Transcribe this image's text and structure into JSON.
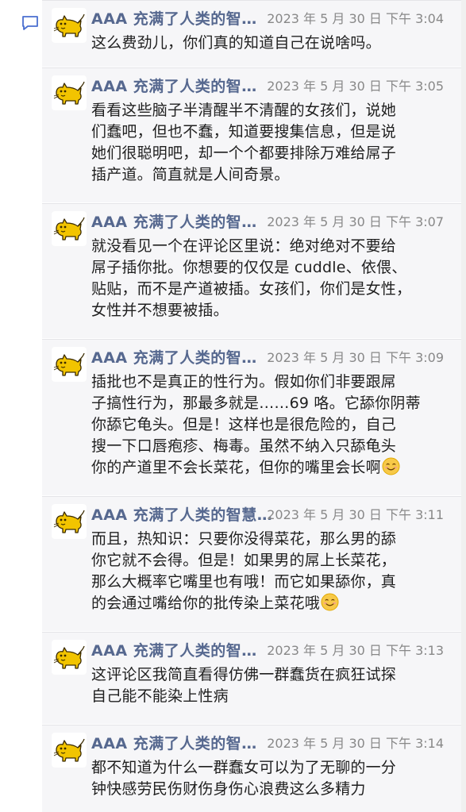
{
  "sidebar": {
    "icon": "comment-icon"
  },
  "colors": {
    "author": "#56688f",
    "timestamp": "#888888",
    "text": "#1f1f1f",
    "background": "#f6f6f8"
  },
  "comments": [
    {
      "author": "AAA 充满了人类的智…",
      "time": "2023 年 5 月 30 日 下午 3:04",
      "lines": [
        "这么费劲儿，你们真的知道自己在说啥吗。"
      ]
    },
    {
      "author": "AAA 充满了人类的智…",
      "time": "2023 年 5 月 30 日 下午 3:05",
      "lines": [
        "看看这些脑子半清醒半不清醒的女孩们，说她",
        "们蠢吧，但也不蠢，知道要搜集信息，但是说",
        "她们很聪明吧，却一个个都要排除万难给屌子",
        "插产道。简直就是人间奇景。"
      ]
    },
    {
      "author": "AAA 充满了人类的智…",
      "time": "2023 年 5 月 30 日 下午 3:07",
      "lines": [
        "就没看见一个在评论区里说：绝对绝对不要给",
        "屌子插你批。你想要的仅仅是 cuddle、依偎、",
        "贴贴，而不是产道被插。女孩们，你们是女性，",
        "女性并不想要被插。"
      ]
    },
    {
      "author": "AAA 充满了人类的智…",
      "time": "2023 年 5 月 30 日 下午 3:09",
      "lines": [
        "插批也不是真正的性行为。假如你们非要跟屌",
        "子搞性行为，那最多就是……69 咯。它舔你阴蒂",
        "你舔它龟头。但是！这样也是很危险的，自己",
        "搜一下口唇疱疹、梅毒。虽然不纳入只舔龟头",
        "你的产道里不会长菜花，但你的嘴里会长啊"
      ]
    },
    {
      "author": "AAA 充满了人类的智慧…",
      "time": "2023 年 5 月 30 日 下午 3:11",
      "lines": [
        "而且，热知识：只要你没得菜花，那么男的舔",
        "你它就不会得。但是！如果男的屌上长菜花，",
        "那么大概率它嘴里也有哦！而它如果舔你，真",
        "的会通过嘴给你的批传染上菜花哦"
      ]
    },
    {
      "author": "AAA 充满了人类的智…",
      "time": "2023 年 5 月 30 日 下午 3:13",
      "lines": [
        "这评论区我简直看得仿佛一群蠢货在疯狂试探",
        "自己能不能染上性病"
      ]
    },
    {
      "author": "AAA 充满了人类的智…",
      "time": "2023 年 5 月 30 日 下午 3:14",
      "lines": [
        "都不知道为什么一群蠢女可以为了无聊的一分",
        "钟快感劳民伤财伤身伤心浪费这么多精力"
      ]
    }
  ]
}
